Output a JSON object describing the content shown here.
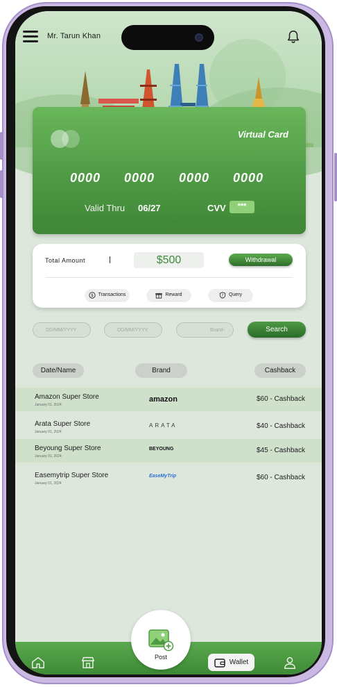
{
  "header": {
    "user_name": "Mr. Tarun Khan"
  },
  "virtual_card": {
    "title": "Virtual Card",
    "number_groups": [
      "0000",
      "0000",
      "0000",
      "0000"
    ],
    "valid_thru_label": "Valid Thru",
    "valid_thru_value": "06/27",
    "cvv_label": "CVV",
    "cvv_value": "***"
  },
  "amount_panel": {
    "label": "Total Amount",
    "amount": "$500",
    "withdraw_label": "Withdrawal",
    "pills": [
      {
        "label": "Transactions",
        "icon": "dollar-coin-icon"
      },
      {
        "label": "Reward",
        "icon": "gift-icon"
      },
      {
        "label": "Query",
        "icon": "shield-question-icon"
      }
    ]
  },
  "filters": {
    "from_date_placeholder": "DD/MM/YYYY",
    "to_date_placeholder": "DD/MM/YYYY",
    "brand_placeholder": "Brand",
    "search_label": "Search"
  },
  "table": {
    "headers": [
      "Date/Name",
      "Brand",
      "Cashback"
    ],
    "rows": [
      {
        "name": "Amazon Super Store",
        "date": "January 01, 2024",
        "brand": "amazon",
        "cashback": "$60 -  Cashback"
      },
      {
        "name": "Arata Super Store",
        "date": "January 01, 2024",
        "brand": "ARATA",
        "cashback": "$40 -  Cashback"
      },
      {
        "name": "Beyoung Super Store",
        "date": "January 01, 2024",
        "brand": "BEYOUNG",
        "cashback": "$45 -  Cashback"
      },
      {
        "name": "Easemytrip Super Store",
        "date": "January 01, 2024",
        "brand": "EaseMyTrip",
        "cashback": "$60 -  Cashback"
      }
    ]
  },
  "bottom_nav": {
    "post_label": "Post",
    "wallet_label": "Wallet"
  },
  "colors": {
    "primary_green": "#4f9a45",
    "light_green": "#cfe0cb",
    "background": "#dde7dc"
  }
}
